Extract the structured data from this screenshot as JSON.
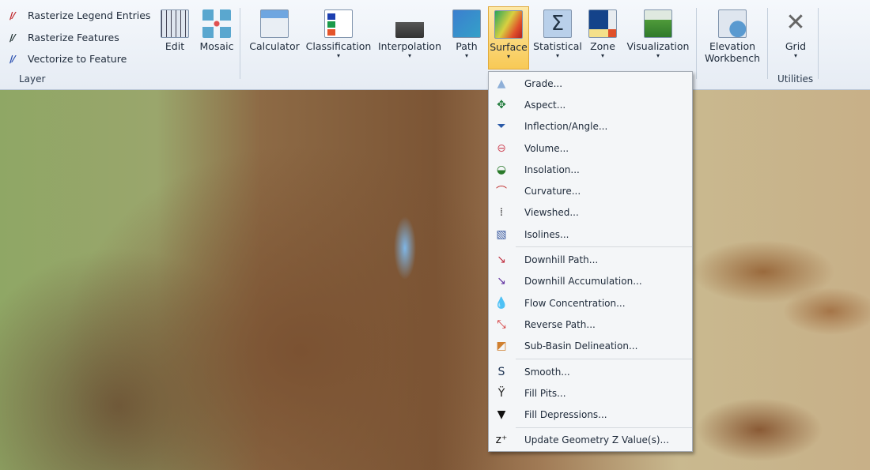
{
  "ribbon": {
    "layer_group": {
      "label": "Layer",
      "items": [
        "Rasterize Legend Entries",
        "Rasterize Features",
        "Vectorize to Feature"
      ]
    },
    "buttons": [
      {
        "label": "Edit",
        "icon": "grid-edit-icon",
        "dropdown": false
      },
      {
        "label": "Mosaic",
        "icon": "mosaic-icon",
        "dropdown": false
      },
      {
        "label": "Calculator",
        "icon": "calculator-icon",
        "dropdown": false
      },
      {
        "label": "Classification",
        "icon": "classification-icon",
        "dropdown": true
      },
      {
        "label": "Interpolation",
        "icon": "interpolation-icon",
        "dropdown": true
      },
      {
        "label": "Path",
        "icon": "path-icon",
        "dropdown": true
      },
      {
        "label": "Surface",
        "icon": "surface-icon",
        "dropdown": true,
        "active": true
      },
      {
        "label": "Statistical",
        "icon": "sigma-icon",
        "dropdown": true
      },
      {
        "label": "Zone",
        "icon": "zone-icon",
        "dropdown": true
      },
      {
        "label": "Visualization",
        "icon": "landscape-icon",
        "dropdown": true
      },
      {
        "label": "Elevation Workbench",
        "icon": "workbench-icon",
        "dropdown": false
      },
      {
        "label": "Grid",
        "icon": "tools-icon",
        "dropdown": true
      }
    ],
    "utilities_label": "Utilities",
    "dropdown_arrow": "▾"
  },
  "surface_menu": {
    "groups": [
      [
        "Grade...",
        "Aspect...",
        "Inflection/Angle...",
        "Volume...",
        "Insolation...",
        "Curvature...",
        "Viewshed...",
        "Isolines..."
      ],
      [
        "Downhill Path...",
        "Downhill Accumulation...",
        "Flow Concentration...",
        "Reverse Path...",
        "Sub-Basin Delineation..."
      ],
      [
        "Smooth...",
        "Fill Pits...",
        "Fill Depressions..."
      ],
      [
        "Update Geometry Z Value(s)..."
      ]
    ]
  },
  "colors": {
    "active": "#f8c955",
    "menu_bg": "#f4f6f8"
  }
}
